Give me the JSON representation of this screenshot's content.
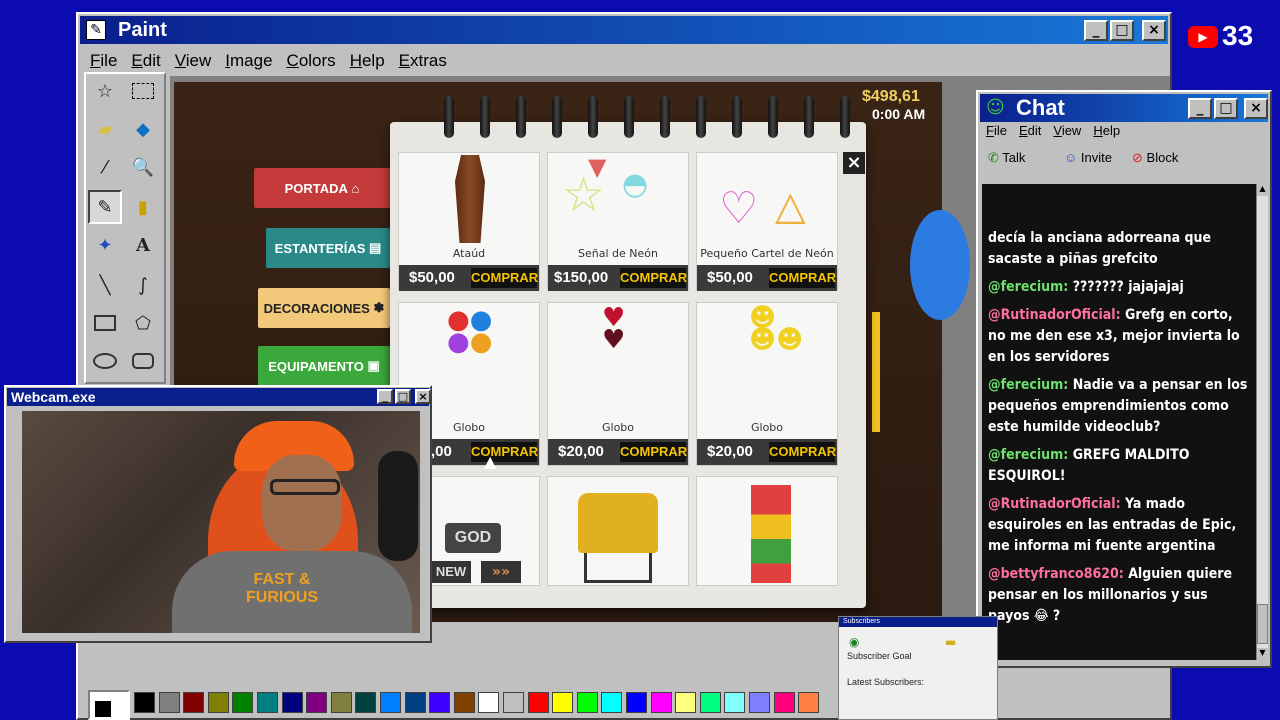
{
  "paint": {
    "title": "Paint",
    "menu": [
      "File",
      "Edit",
      "View",
      "Image",
      "Colors",
      "Help",
      "Extras"
    ]
  },
  "youtube_count": "33",
  "game": {
    "money": "$498,61",
    "time": "0:00 AM",
    "sidebar": [
      {
        "label": "PORTADA",
        "color": "#c43a3a"
      },
      {
        "label": "ESTANTERÍAS",
        "color": "#2a8a8a"
      },
      {
        "label": "DECORACIONES",
        "color": "#f0c070"
      },
      {
        "label": "EQUIPAMENTO",
        "color": "#3aa83a"
      }
    ],
    "close_label": "×",
    "buy_label": "COMPRAR",
    "items": [
      {
        "name": "Ataúd",
        "price": "$50,00"
      },
      {
        "name": "Señal de Neón",
        "price": "$150,00"
      },
      {
        "name": "Pequeño Cartel de Neón",
        "price": "$50,00"
      },
      {
        "name": "Globo",
        "price": ",00"
      },
      {
        "name": "Globo",
        "price": "$20,00"
      },
      {
        "name": "Globo",
        "price": "$20,00"
      }
    ],
    "sign_text": "GOD",
    "sign_new": "NEW"
  },
  "webcam": {
    "title": "Webcam.exe",
    "shirt_text": "FAST & FURIOUS"
  },
  "chat": {
    "title": "Chat",
    "menu": [
      "File",
      "Edit",
      "View",
      "Help"
    ],
    "toolbar": [
      "Talk",
      "Invite",
      "Block"
    ],
    "messages": [
      {
        "user": "",
        "text": "decía la anciana adorreana que sacaste a piñas grefcito"
      },
      {
        "user": "@ferecium:",
        "text": "??????? jajajajaj"
      },
      {
        "user": "@RutinadorOficial:",
        "text": "Grefg en corto, no me den ese x3, mejor invierta lo en los servidores"
      },
      {
        "user": "@ferecium:",
        "text": "Nadie va a pensar en los pequeños emprendimientos como este humilde videoclub?"
      },
      {
        "user": "@ferecium:",
        "text": "GREFG MALDITO ESQUIROL!"
      },
      {
        "user": "@RutinadorOficial:",
        "text": "Ya mado esquiroles en las entradas de Epic, me informa mi fuente argentina"
      },
      {
        "user": "@bettyfranco8620:",
        "text": "Alguien quiere pensar en los millonarios y sus payos 😂 ?"
      }
    ]
  },
  "subscribers": {
    "title": "Subscribers",
    "goal": "Subscriber Goal",
    "latest": "Latest Subscribers:"
  },
  "palette": [
    "#000000",
    "#808080",
    "#800000",
    "#808000",
    "#008000",
    "#008080",
    "#000080",
    "#800080",
    "#808040",
    "#004040",
    "#0080ff",
    "#004080",
    "#4000ff",
    "#804000",
    "#ffffff",
    "#c0c0c0",
    "#ff0000",
    "#ffff00",
    "#00ff00",
    "#00ffff",
    "#0000ff",
    "#ff00ff",
    "#ffff80",
    "#00ff80",
    "#80ffff",
    "#8080ff",
    "#ff0080",
    "#ff8040"
  ]
}
